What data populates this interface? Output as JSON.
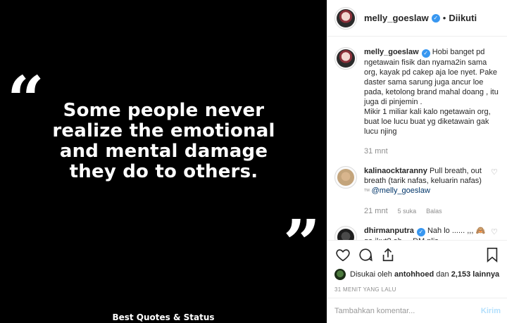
{
  "media": {
    "quote_open": "“",
    "quote_close": "”",
    "quote_line1": "Some people never",
    "quote_line2": "realize the emotional",
    "quote_line3": "and mental damage",
    "quote_line4": "they do to others.",
    "credit": "Best Quotes & Status"
  },
  "header": {
    "username": "melly_goeslaw",
    "verified_icon": "verified-badge-icon",
    "separator": "•",
    "follow_status": "Diikuti"
  },
  "caption": {
    "username": "melly_goeslaw",
    "text_line1": "Hobi banget pd ngetawain fisik dan nyama2in sama org, kayak pd cakep aja loe nyet. Pake daster sama sarung juga ancur loe pada, ketolong brand mahal doang , itu juga di pinjemin .",
    "text_line2": "Mikir 1 miliar kali kalo ngetawain org, buat loe lucu buat yg diketawain gak lucu njing",
    "time": "31 mnt"
  },
  "comments": [
    {
      "username": "kalinaocktaranny",
      "text": "Pull breath, out breath (tarik nafas, keluarin nafas)",
      "translation_icon": "translate-icon",
      "translation_mark": "ᵀᴹ",
      "mention": "@melly_goeslaw",
      "time": "21 mnt",
      "likes": "5 suka",
      "reply": "Balas"
    },
    {
      "username": "dhirmanputra",
      "text": "Nah lo ...... ,,, 🙈 ga ikut? ah ... DM plis ...",
      "time": "",
      "likes": "",
      "reply": ""
    }
  ],
  "actions": {
    "like_icon": "heart-icon",
    "comment_icon": "comment-icon",
    "share_icon": "share-icon",
    "save_icon": "bookmark-icon"
  },
  "likes": {
    "prefix": "Disukai oleh",
    "user": "antohhoed",
    "connector": "dan",
    "count": "2,153 lainnya"
  },
  "timestamp": "31 MENIT YANG LALU",
  "add_comment": {
    "placeholder": "Tambahkan komentar...",
    "send_label": "Kirim"
  },
  "colors": {
    "verified": "#3897f0",
    "send_disabled": "#b2dffc",
    "muted": "#8e8e8e"
  }
}
